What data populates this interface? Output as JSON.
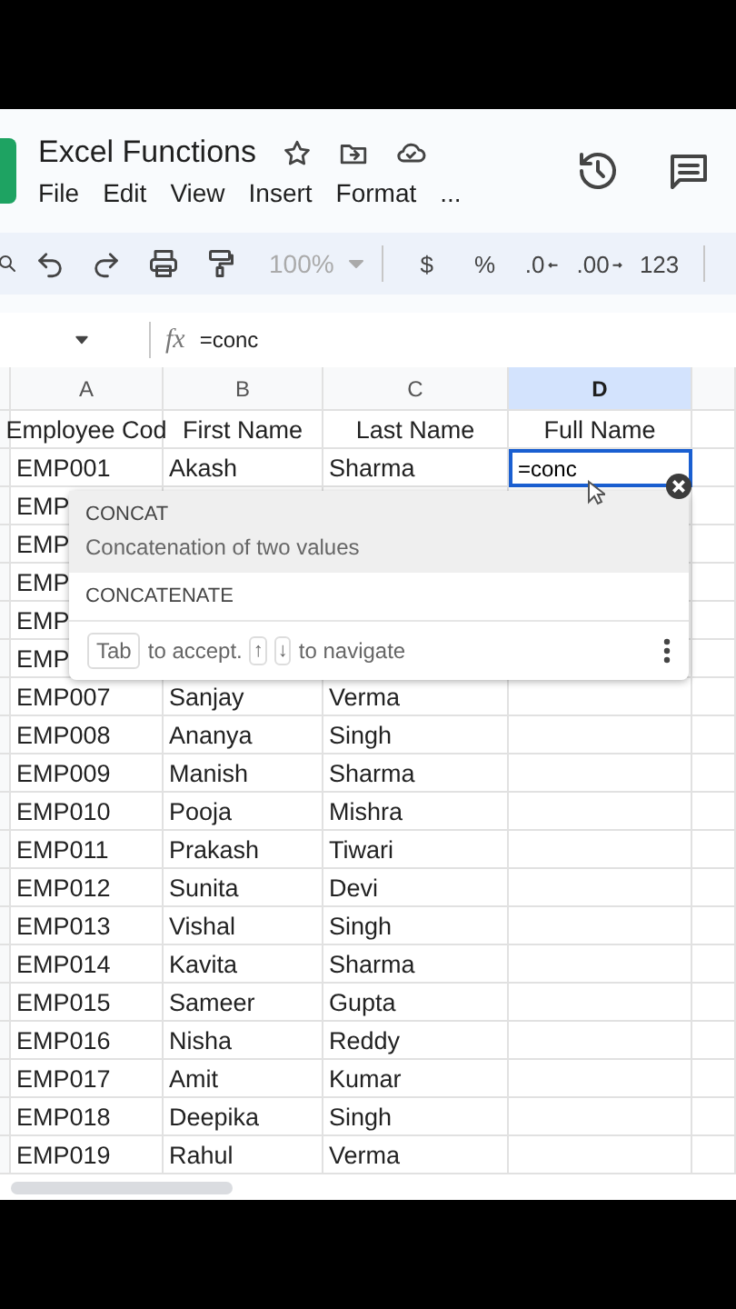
{
  "title": "Excel Functions",
  "menu": [
    "File",
    "Edit",
    "View",
    "Insert",
    "Format",
    "..."
  ],
  "toolbar": {
    "zoom": "100%",
    "formats": [
      "$",
      "%",
      ".0",
      ".00",
      "123"
    ]
  },
  "formula_bar": {
    "fx": "fx",
    "formula": "=conc"
  },
  "columns": [
    {
      "label": "A",
      "selected": false
    },
    {
      "label": "B",
      "selected": false
    },
    {
      "label": "C",
      "selected": false
    },
    {
      "label": "D",
      "selected": true
    }
  ],
  "header_row": [
    "Employee Cod",
    "First Name",
    "Last Name",
    "Full Name"
  ],
  "rows": [
    {
      "code": "EMP001",
      "first": "Akash",
      "last": "Sharma",
      "full_name_input": "=conc"
    },
    {
      "code": "EMP"
    },
    {
      "code": "EMP"
    },
    {
      "code": "EMP"
    },
    {
      "code": "EMP"
    },
    {
      "code": "EMP"
    },
    {
      "code": "EMP007",
      "first": "Sanjay",
      "last": "Verma"
    },
    {
      "code": "EMP008",
      "first": "Ananya",
      "last": "Singh"
    },
    {
      "code": "EMP009",
      "first": "Manish",
      "last": "Sharma"
    },
    {
      "code": "EMP010",
      "first": "Pooja",
      "last": "Mishra"
    },
    {
      "code": "EMP011",
      "first": "Prakash",
      "last": "Tiwari"
    },
    {
      "code": "EMP012",
      "first": "Sunita",
      "last": "Devi"
    },
    {
      "code": "EMP013",
      "first": "Vishal",
      "last": "Singh"
    },
    {
      "code": "EMP014",
      "first": "Kavita",
      "last": "Sharma"
    },
    {
      "code": "EMP015",
      "first": "Sameer",
      "last": "Gupta"
    },
    {
      "code": "EMP016",
      "first": "Nisha",
      "last": "Reddy"
    },
    {
      "code": "EMP017",
      "first": "Amit",
      "last": "Kumar"
    },
    {
      "code": "EMP018",
      "first": "Deepika",
      "last": "Singh"
    },
    {
      "code": "EMP019",
      "first": "Rahul",
      "last": "Verma"
    }
  ],
  "autocomplete": {
    "items": [
      {
        "name": "CONCAT",
        "description": "Concatenation of two values",
        "selected": true
      },
      {
        "name": "CONCATENATE",
        "selected": false
      }
    ],
    "hint": {
      "key": "Tab",
      "accept": "to accept.",
      "up": "↑",
      "down": "↓",
      "navigate": "to navigate"
    }
  }
}
